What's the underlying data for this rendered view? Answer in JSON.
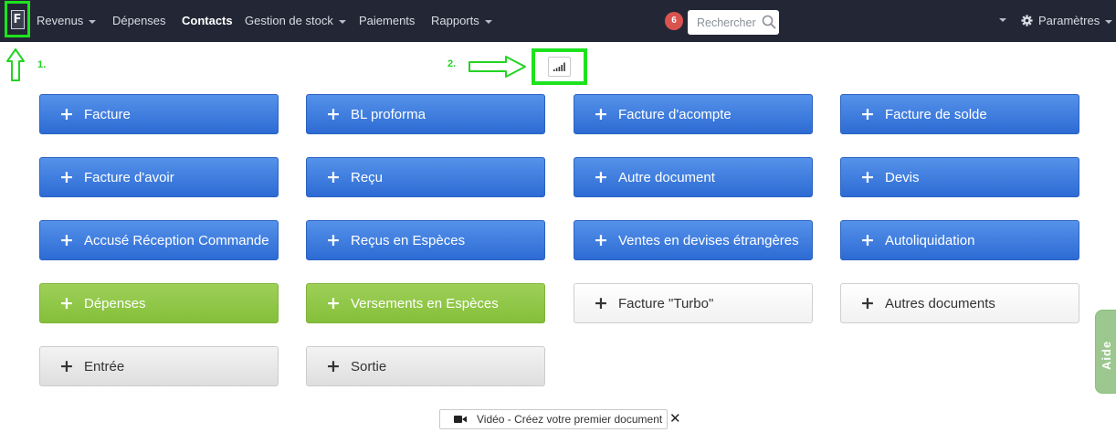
{
  "navbar": {
    "logo_letter": "F",
    "items": [
      {
        "label": "Revenus",
        "dropdown": true,
        "active": false
      },
      {
        "label": "Dépenses",
        "dropdown": false,
        "active": false
      },
      {
        "label": "Contacts",
        "dropdown": false,
        "active": true
      },
      {
        "label": "Gestion de stock",
        "dropdown": true,
        "active": false
      },
      {
        "label": "Paiements",
        "dropdown": false,
        "active": false
      },
      {
        "label": "Rapports",
        "dropdown": true,
        "active": false
      }
    ],
    "notification_count": "6",
    "search_placeholder": "Rechercher",
    "settings_label": "Paramètres"
  },
  "annotations": {
    "marker_1": "1.",
    "marker_2": "2."
  },
  "documents": [
    {
      "label": "Facture",
      "style": "blue"
    },
    {
      "label": "BL proforma",
      "style": "blue"
    },
    {
      "label": "Facture d'acompte",
      "style": "blue"
    },
    {
      "label": "Facture de solde",
      "style": "blue"
    },
    {
      "label": "Facture d'avoir",
      "style": "blue"
    },
    {
      "label": "Reçu",
      "style": "blue"
    },
    {
      "label": "Autre document",
      "style": "blue"
    },
    {
      "label": "Devis",
      "style": "blue"
    },
    {
      "label": "Accusé Réception Commande",
      "style": "blue"
    },
    {
      "label": "Reçus en Espèces",
      "style": "blue"
    },
    {
      "label": "Ventes en devises étrangères",
      "style": "blue"
    },
    {
      "label": "Autoliquidation",
      "style": "blue"
    },
    {
      "label": "Dépenses",
      "style": "green"
    },
    {
      "label": "Versements en Espèces",
      "style": "green"
    },
    {
      "label": "Facture \"Turbo\"",
      "style": "white"
    },
    {
      "label": "Autres documents",
      "style": "white"
    },
    {
      "label": "Entrée",
      "style": "gray"
    },
    {
      "label": "Sortie",
      "style": "gray"
    }
  ],
  "plus_symbol": "+",
  "video": {
    "label": "Vidéo - Créez votre premier document",
    "close_symbol": "✕"
  },
  "help_tab": {
    "label": "Aide"
  },
  "colors": {
    "navbar": "#232735",
    "accent_green": "#1ee21e",
    "button_blue": "#2d6bd4",
    "button_green": "#84bf3a",
    "badge_red": "#d9534f",
    "help_green": "#9cc88f"
  },
  "icons": [
    "logo-icon",
    "search-icon",
    "gear-icon",
    "signal-chart-icon",
    "video-camera-icon",
    "close-icon",
    "plus-icon",
    "arrow-up-icon",
    "arrow-right-icon",
    "chevron-down-icon"
  ]
}
